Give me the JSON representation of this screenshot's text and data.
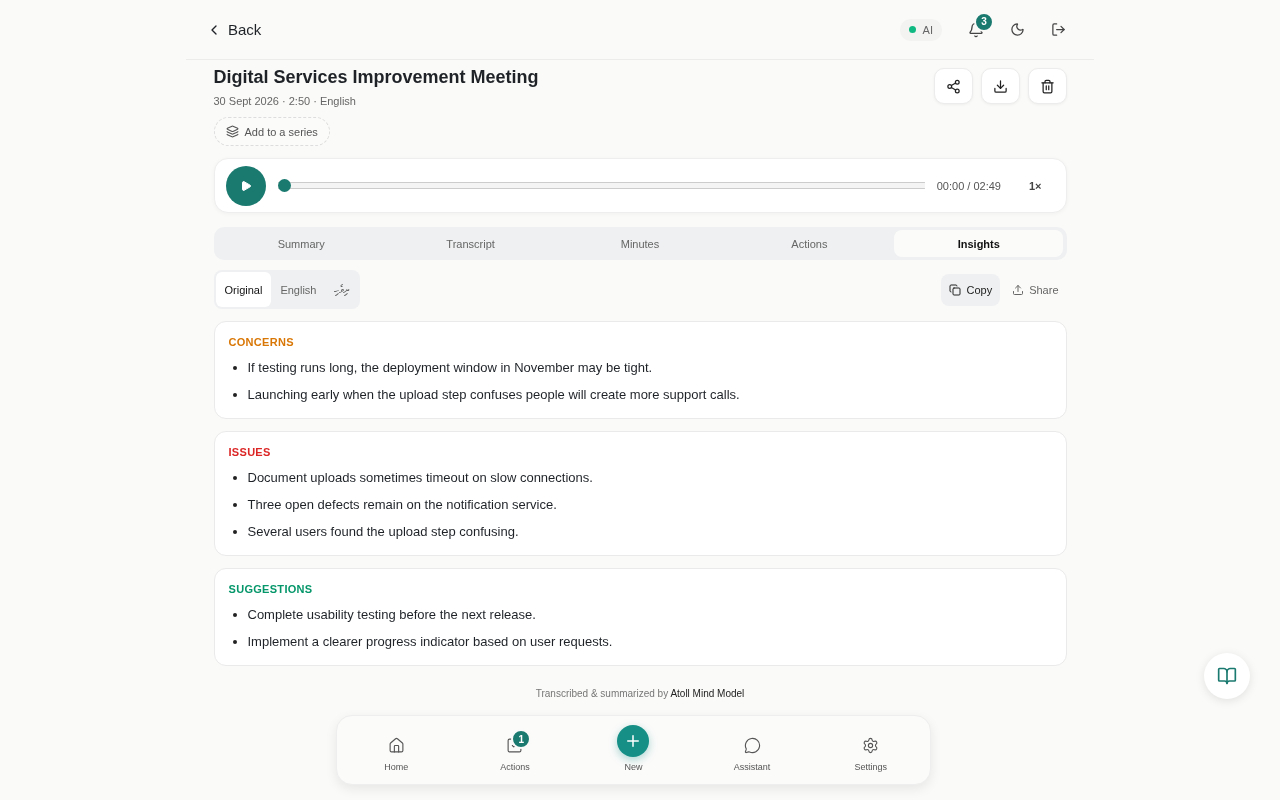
{
  "header": {
    "back_label": "Back",
    "ai_badge": "AI",
    "ai_on": true,
    "notification_count": "3"
  },
  "meeting": {
    "title": "Digital Services Improvement Meeting",
    "meta": "30 Sept 2026 · 2:50 · English",
    "series_button": "Add to a series"
  },
  "player": {
    "level": 0,
    "time": "00:00 / 02:49",
    "speed": "1×"
  },
  "tabs": [
    {
      "label": "Summary",
      "selected": false
    },
    {
      "label": "Transcript",
      "selected": false
    },
    {
      "label": "Minutes",
      "selected": false
    },
    {
      "label": "Actions",
      "selected": false
    },
    {
      "label": "Insights",
      "selected": true
    }
  ],
  "languages": [
    {
      "label": "Original",
      "selected": true
    },
    {
      "label": "English",
      "selected": false
    },
    {
      "label": "ދިވެހި",
      "selected": false
    }
  ],
  "copy_button": "Copy",
  "share_button": "Share",
  "sections": [
    {
      "heading": "CONCERNS",
      "color": "#d97706",
      "items": [
        "If testing runs long, the deployment window in November may be tight.",
        "Launching early when the upload step confuses people will create more support calls."
      ]
    },
    {
      "heading": "ISSUES",
      "color": "#dc2626",
      "items": [
        "Document uploads sometimes timeout on slow connections.",
        "Three open defects remain on the notification service.",
        "Several users found the upload step confusing."
      ]
    },
    {
      "heading": "SUGGESTIONS",
      "color": "#059669",
      "items": [
        "Complete usability testing before the next release.",
        "Implement a clearer progress indicator based on user requests."
      ]
    }
  ],
  "footer": "Transcribed & summarized by **Atoll Mind Model**",
  "bottom_nav": [
    {
      "kind": "home",
      "label": "Home"
    },
    {
      "kind": "actions",
      "label": "Actions",
      "badge": "1"
    },
    {
      "kind": "new",
      "label": "New"
    },
    {
      "kind": "assistant",
      "label": "Assistant"
    },
    {
      "kind": "settings",
      "label": "Settings"
    }
  ]
}
